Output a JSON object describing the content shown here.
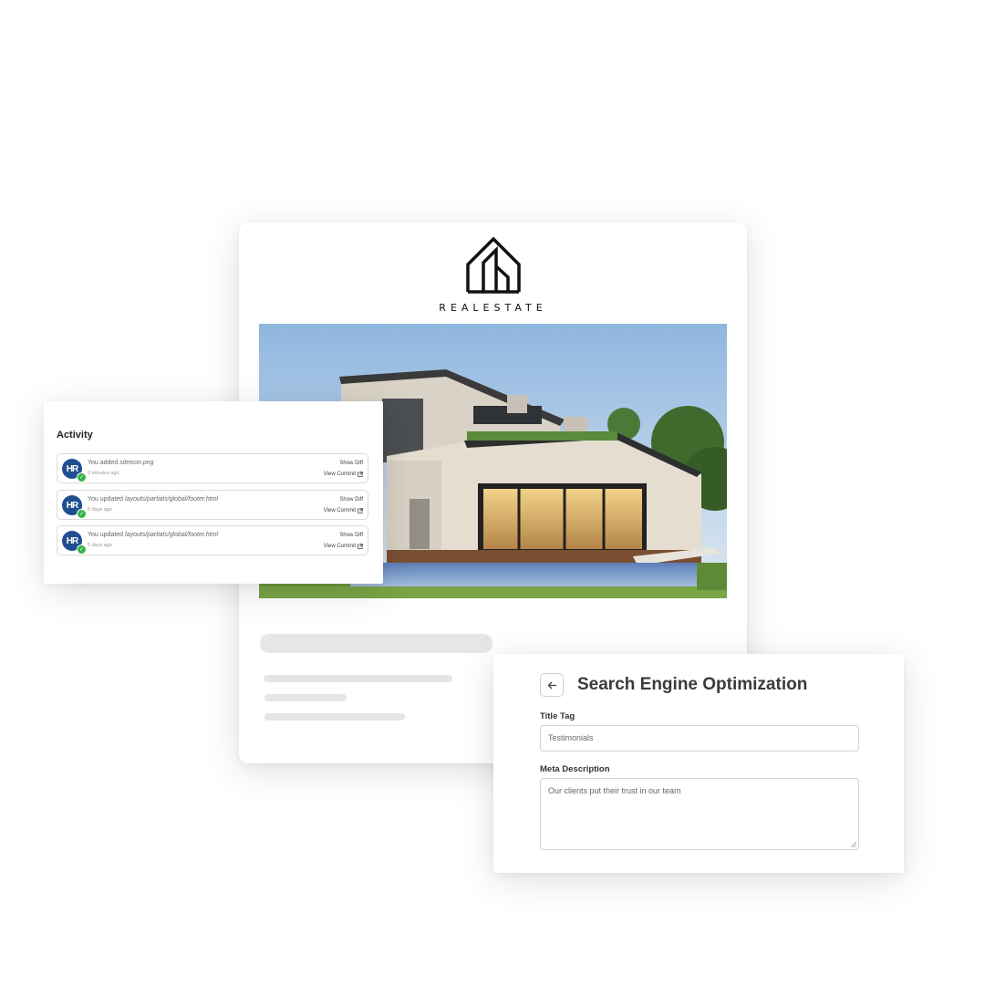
{
  "site": {
    "brand": "REALESTATE",
    "logo_icon": "house-logo-icon",
    "hero_image": "modern-house-photo"
  },
  "activity": {
    "title": "Activity",
    "items": [
      {
        "avatar": "HR",
        "prefix": "You added ",
        "file": "siteicon.png",
        "time": "2 minutes ago",
        "show_diff": "Show Diff",
        "view_commit": "View Commit"
      },
      {
        "avatar": "HR",
        "prefix": "You updated ",
        "file": "layouts/partials/global/footer.html",
        "time": "5 days ago",
        "show_diff": "Show Diff",
        "view_commit": "View Commit"
      },
      {
        "avatar": "HR",
        "prefix": "You updated ",
        "file": "layouts/partials/global/footer.html",
        "time": "5 days ago",
        "show_diff": "Show Diff",
        "view_commit": "View Commit"
      }
    ]
  },
  "seo": {
    "title": "Search Engine Optimization",
    "back_icon": "arrow-left-icon",
    "title_tag_label": "Title Tag",
    "title_tag_value": "Testimonials",
    "meta_label": "Meta Description",
    "meta_value": "Our clients put their trust in our team"
  },
  "colors": {
    "avatar": "#1f4f91",
    "success": "#36b34a",
    "placeholder": "#e6e6e6"
  }
}
